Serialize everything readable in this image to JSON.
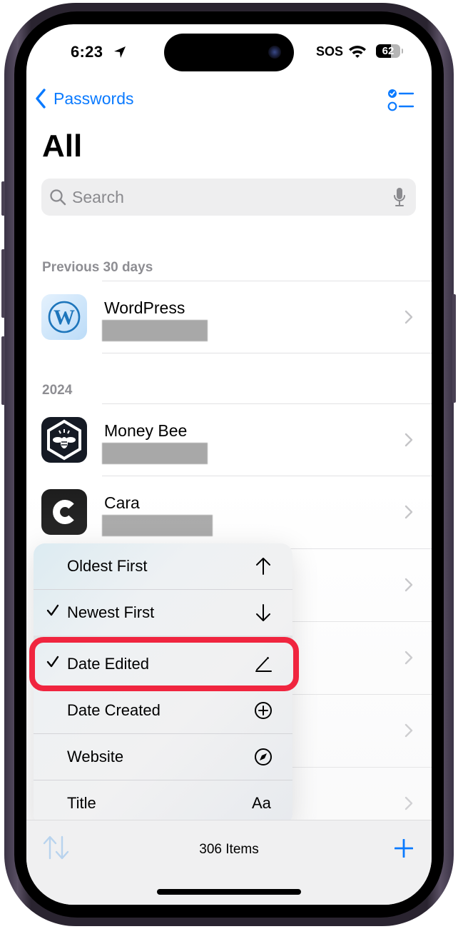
{
  "status_bar": {
    "time": "6:23",
    "carrier": "SOS",
    "battery_percent": 62,
    "battery_label": "62"
  },
  "nav": {
    "back_label": "Passwords",
    "title": "All"
  },
  "search": {
    "placeholder": "Search",
    "value": ""
  },
  "sections": [
    {
      "header": "Previous 30 days",
      "items": [
        {
          "title": "WordPress",
          "subtitle": "[redacted]",
          "icon": "wordpress-logo",
          "icon_bg": "#cfe6fb",
          "icon_fg": "#1d75bb"
        }
      ]
    },
    {
      "header": "2024",
      "items": [
        {
          "title": "Money Bee",
          "subtitle": "[redacted]",
          "icon": "money-bee-logo",
          "icon_bg": "#151a24",
          "icon_fg": "#ffffff"
        },
        {
          "title": "Cara",
          "subtitle": "[redacted]",
          "icon": "cara-logo",
          "icon_bg": "#1c1c1c",
          "icon_fg": "#ffffff"
        }
      ]
    }
  ],
  "sort_menu": {
    "order_options": [
      {
        "label": "Oldest First",
        "checked": false,
        "icon": "arrow-up-icon"
      },
      {
        "label": "Newest First",
        "checked": true,
        "icon": "arrow-down-icon"
      }
    ],
    "sort_by_options": [
      {
        "label": "Date Edited",
        "checked": true,
        "icon": "pencil-line-icon",
        "highlighted": true
      },
      {
        "label": "Date Created",
        "checked": false,
        "icon": "plus-circle-icon"
      },
      {
        "label": "Website",
        "checked": false,
        "icon": "compass-icon"
      },
      {
        "label": "Title",
        "checked": false,
        "icon": "text-format-icon",
        "icon_text": "Aa"
      }
    ]
  },
  "toolbar": {
    "items_count": "306 Items"
  },
  "colors": {
    "accent": "#0a7aff",
    "highlight": "#f0253f",
    "secondary_text": "#8e8e93"
  }
}
